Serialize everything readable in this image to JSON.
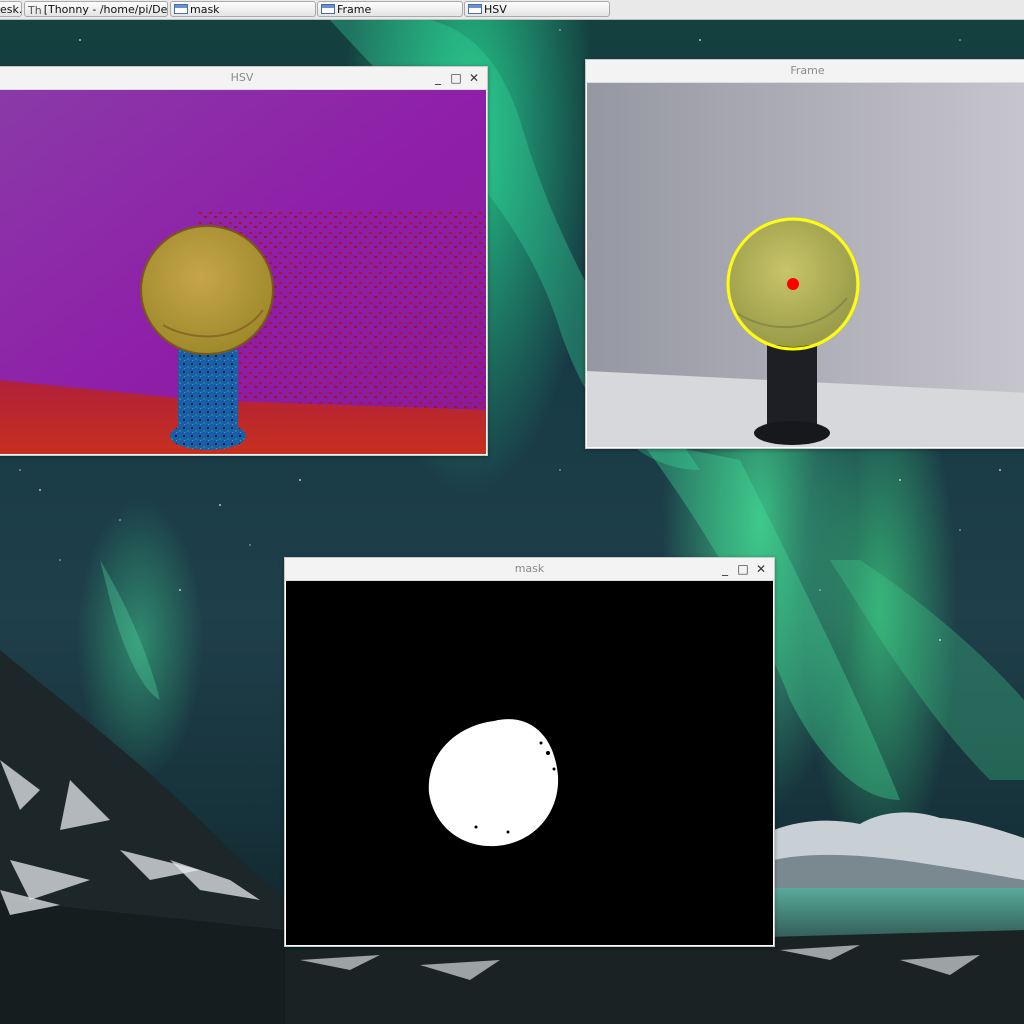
{
  "taskbar": {
    "items": [
      {
        "label": "esk..",
        "icon": "window-icon"
      },
      {
        "label": "[Thonny  -  /home/pi/Des...",
        "icon": "thonny-icon"
      },
      {
        "label": "mask",
        "icon": "window-icon"
      },
      {
        "label": "Frame",
        "icon": "window-icon"
      },
      {
        "label": "HSV",
        "icon": "window-icon"
      }
    ]
  },
  "windows": {
    "hsv": {
      "title": "HSV",
      "image": "hsv-converted-camera-frame-tennis-ball"
    },
    "frame": {
      "title": "Frame",
      "image": "camera-frame-tennis-ball-detected",
      "marker_colors": {
        "circle": "#ffff00",
        "center": "#ff0000"
      }
    },
    "mask": {
      "title": "mask",
      "image": "binary-mask-ball-white-on-black"
    }
  },
  "controls": {
    "minimize": "_",
    "maximize": "□",
    "close": "✕"
  },
  "colors": {
    "taskbar_bg": "#e9e9e9",
    "titlebar_bg": "#f3f3f3",
    "title_text": "#8a8a8a"
  }
}
